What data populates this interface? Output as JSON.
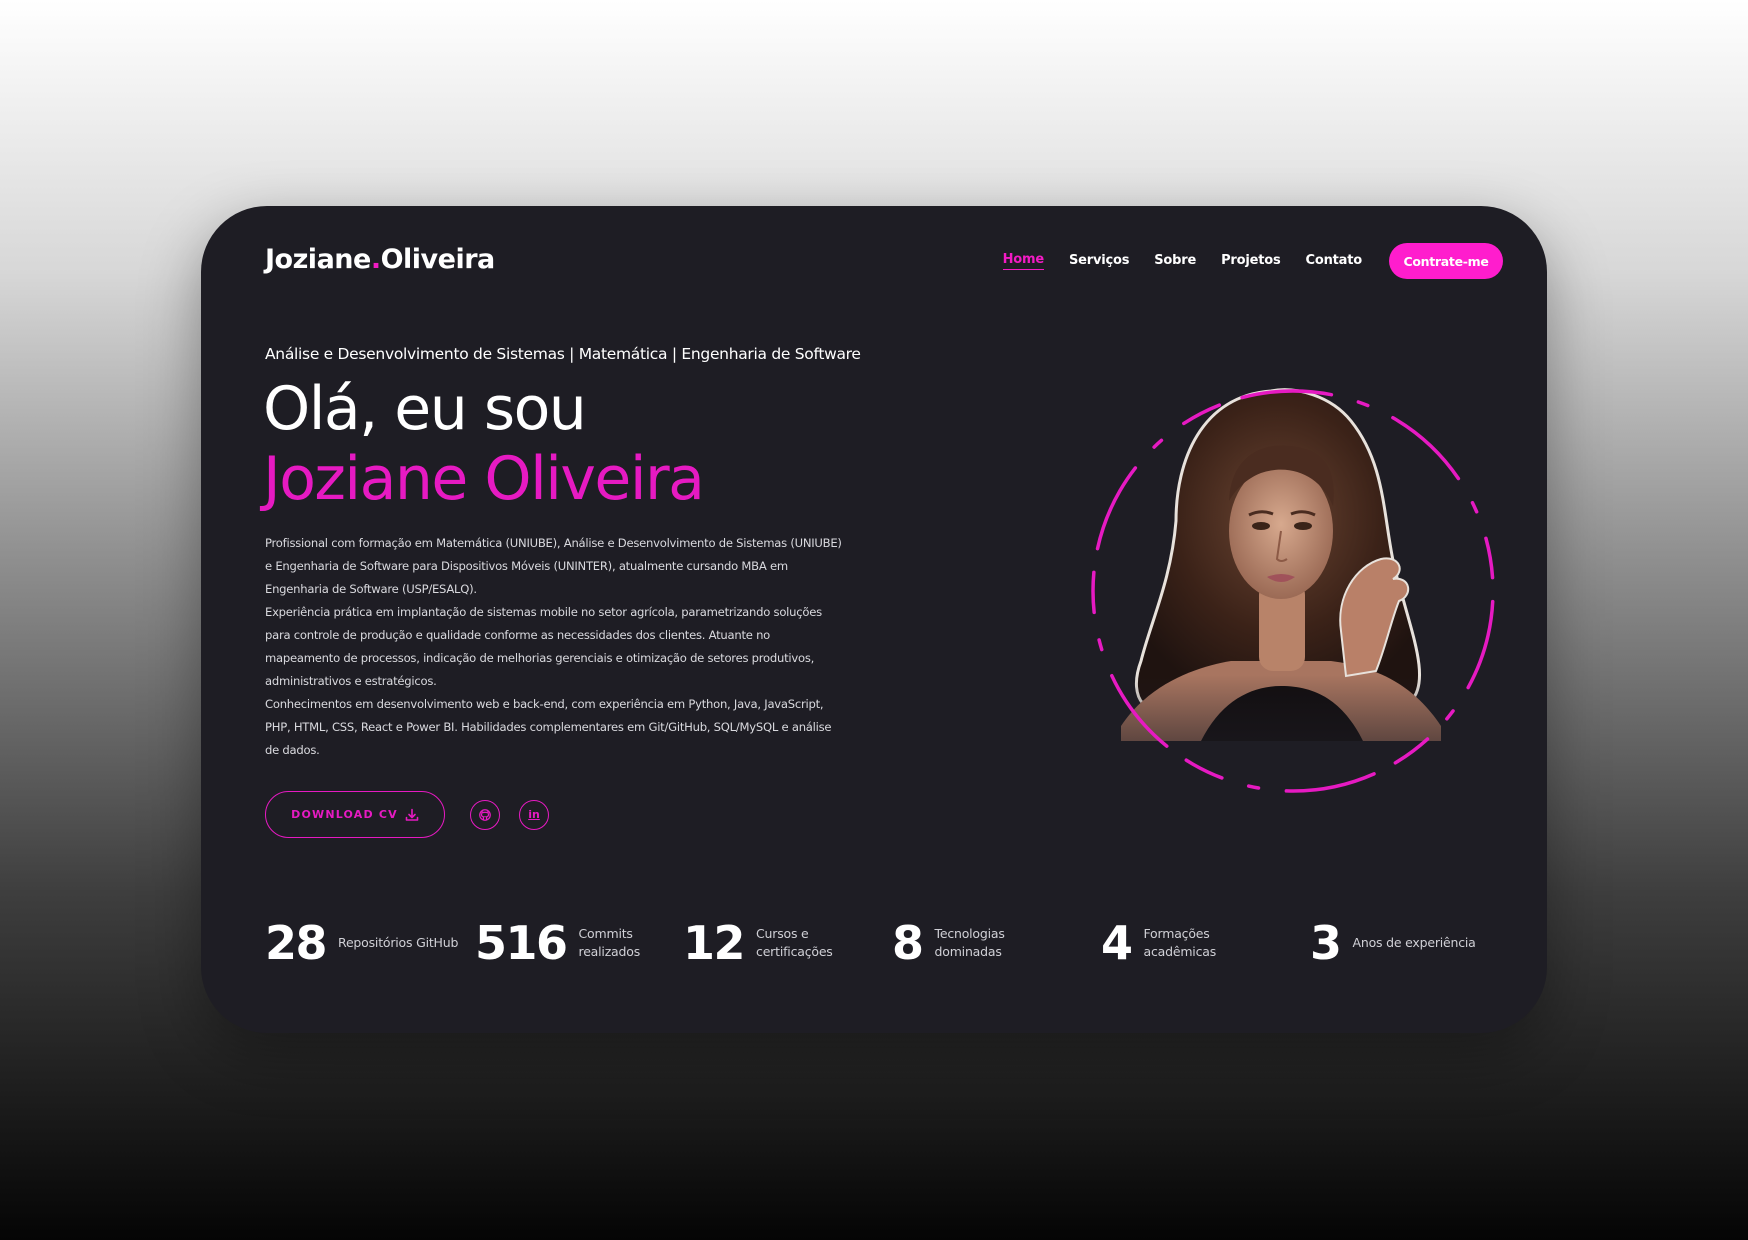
{
  "brand": {
    "first": "Joziane",
    "dot": ".",
    "last": "Oliveira"
  },
  "nav": {
    "items": [
      "Home",
      "Serviços",
      "Sobre",
      "Projetos",
      "Contato"
    ],
    "active": "Home",
    "cta": "Contrate-me"
  },
  "hero": {
    "subtitle": "Análise e Desenvolvimento de Sistemas | Matemática | Engenharia de Software",
    "greeting": "Olá, eu sou",
    "name": "Joziane Oliveira",
    "paragraphs": [
      "Profissional com formação em Matemática (UNIUBE), Análise e Desenvolvimento de Sistemas (UNIUBE) e Engenharia de Software para Dispositivos Móveis (UNINTER), atualmente cursando MBA em Engenharia de Software (USP/ESALQ).",
      "Experiência prática em implantação de sistemas mobile no setor agrícola, parametrizando soluções para controle de produção e qualidade conforme as necessidades dos clientes. Atuante no mapeamento de processos, indicação de melhorias gerenciais e otimização de setores produtivos, administrativos e estratégicos.",
      "Conhecimentos em desenvolvimento web e back-end, com experiência em Python, Java, JavaScript, PHP, HTML, CSS, React e Power BI. Habilidades complementares em Git/GitHub, SQL/MySQL e análise de dados."
    ],
    "download_label": "DOWNLOAD CV",
    "download_icon": "download-icon",
    "social": [
      {
        "name": "github-icon",
        "glyph": ""
      },
      {
        "name": "linkedin-icon",
        "glyph": "in"
      }
    ]
  },
  "stats": [
    {
      "value": "28",
      "label": "Repositórios GitHub"
    },
    {
      "value": "516",
      "label": "Commits\nrealizados"
    },
    {
      "value": "12",
      "label": "Cursos e\ncertificações"
    },
    {
      "value": "8",
      "label": "Tecnologias\ndominadas"
    },
    {
      "value": "4",
      "label": "Formações\nacadêmicas"
    },
    {
      "value": "3",
      "label": "Anos de experiência"
    }
  ],
  "colors": {
    "accent": "#f21bc4",
    "card_bg": "#1e1d24",
    "text": "#ffffff"
  }
}
